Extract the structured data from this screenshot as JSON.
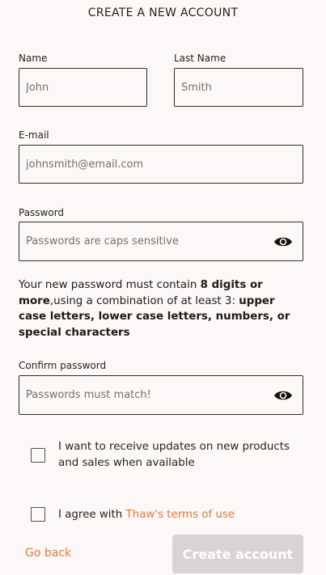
{
  "page_title": "CREATE A NEW ACCOUNT",
  "form": {
    "name": {
      "label": "Name",
      "placeholder": "John"
    },
    "last_name": {
      "label": "Last Name",
      "placeholder": "Smith"
    },
    "email": {
      "label": "E-mail",
      "placeholder": "johnsmith@email.com"
    },
    "password": {
      "label": "Password",
      "placeholder": "Passwords are caps sensitive"
    },
    "password_note": {
      "part1": "Your new password must contain ",
      "bold1": "8 digits or more",
      "part2": ",using a combination of at least 3: ",
      "bold2": "upper case letters, lower case letters, numbers, or special characters"
    },
    "confirm": {
      "label": "Confirm password",
      "placeholder": "Passwords must match!"
    },
    "updates_checkbox": {
      "text": "I want to receive updates on new products and sales when available"
    },
    "terms_checkbox": {
      "prefix": "I agree with ",
      "link": "Thaw's terms of use"
    }
  },
  "actions": {
    "go_back": "Go back",
    "create_account": "Create account"
  },
  "colors": {
    "background": "#fcf8f7",
    "accent": "#e07a3a",
    "disabled_button": "#d8d4d3"
  },
  "icons": {
    "show_password": "eye-icon"
  }
}
